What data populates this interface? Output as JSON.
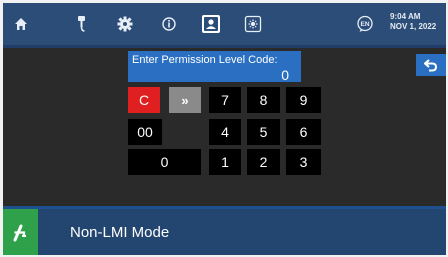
{
  "topbar": {
    "clock_time": "9:04 AM",
    "clock_date": "NOV 1, 2022",
    "language_badge": "EN",
    "icons": [
      "home-icon",
      "boom-icon",
      "gear-icon",
      "info-icon",
      "user-badge-icon",
      "display-icon",
      "language-icon"
    ]
  },
  "keypad": {
    "prompt": "Enter Permission Level Code:",
    "value": "0",
    "clear": "C",
    "advance": "»",
    "double_zero": "00",
    "zero": "0",
    "digits": [
      "1",
      "2",
      "3",
      "4",
      "5",
      "6",
      "7",
      "8",
      "9"
    ]
  },
  "footer": {
    "mode_label": "Non-LMI Mode"
  },
  "colors": {
    "topbar": "#2c4d78",
    "field": "#2a6fc2",
    "clear_key": "#e02020",
    "advance_key": "#8a8a8a",
    "mode_button": "#2fa14b"
  }
}
